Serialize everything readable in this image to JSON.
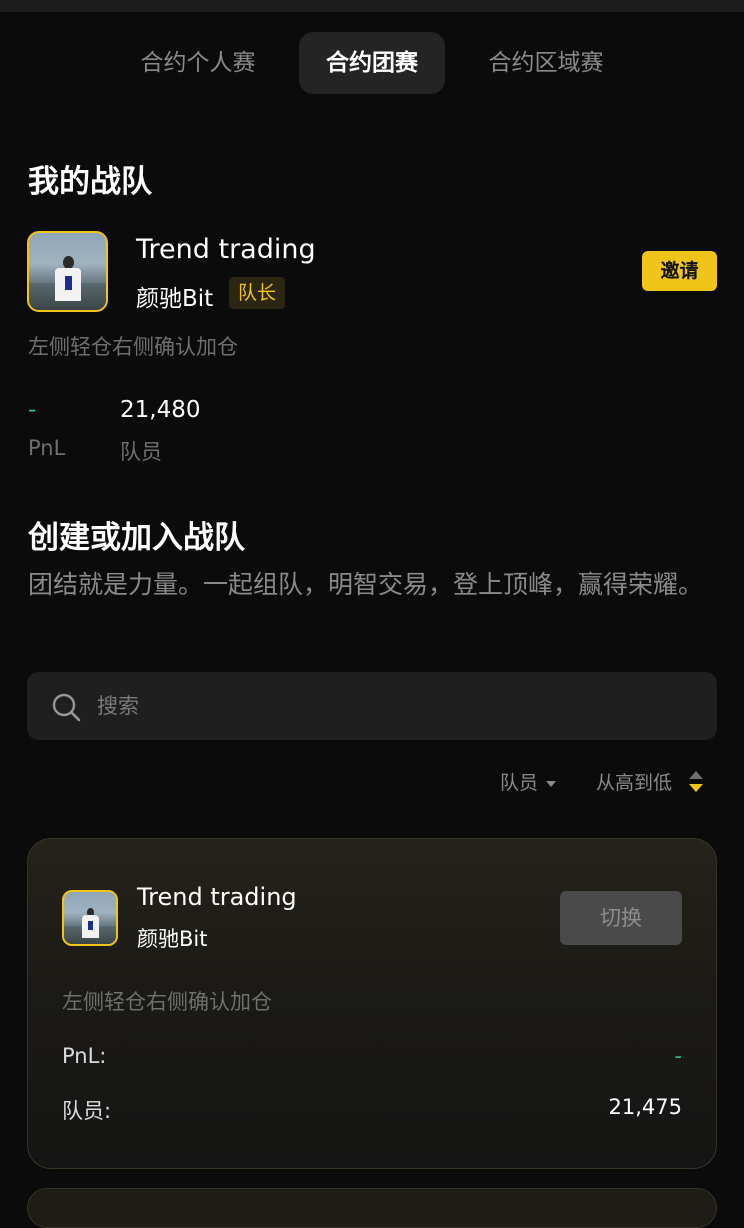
{
  "tabs": [
    {
      "label": "合约个人赛",
      "active": false
    },
    {
      "label": "合约团赛",
      "active": true
    },
    {
      "label": "合约区域赛",
      "active": false
    }
  ],
  "my_team": {
    "heading": "我的战队",
    "team_name": "Trend trading",
    "leader_name": "颜驰Bit",
    "role_badge": "队长",
    "invite_label": "邀请",
    "description": "左侧轻仓右侧确认加仓",
    "stats": {
      "pnl_value": "-",
      "pnl_label": "PnL",
      "members_value": "21,480",
      "members_label": "队员"
    }
  },
  "create_join": {
    "heading": "创建或加入战队",
    "slogan": "团结就是力量。一起组队，明智交易，登上顶峰，赢得荣耀。"
  },
  "search": {
    "placeholder": "搜索",
    "value": ""
  },
  "sort": {
    "field_label": "队员",
    "order_label": "从高到低"
  },
  "team_list": [
    {
      "team_name": "Trend trading",
      "leader_name": "颜驰Bit",
      "switch_label": "切换",
      "description": "左侧轻仓右侧确认加仓",
      "pnl_label": "PnL:",
      "pnl_value": "-",
      "members_label": "队员:",
      "members_value": "21,475"
    }
  ],
  "colors": {
    "background": "#0b0b0b",
    "accent_yellow": "#f0c419",
    "positive_green": "#2ebd85",
    "muted_text": "#6f6f6f"
  }
}
